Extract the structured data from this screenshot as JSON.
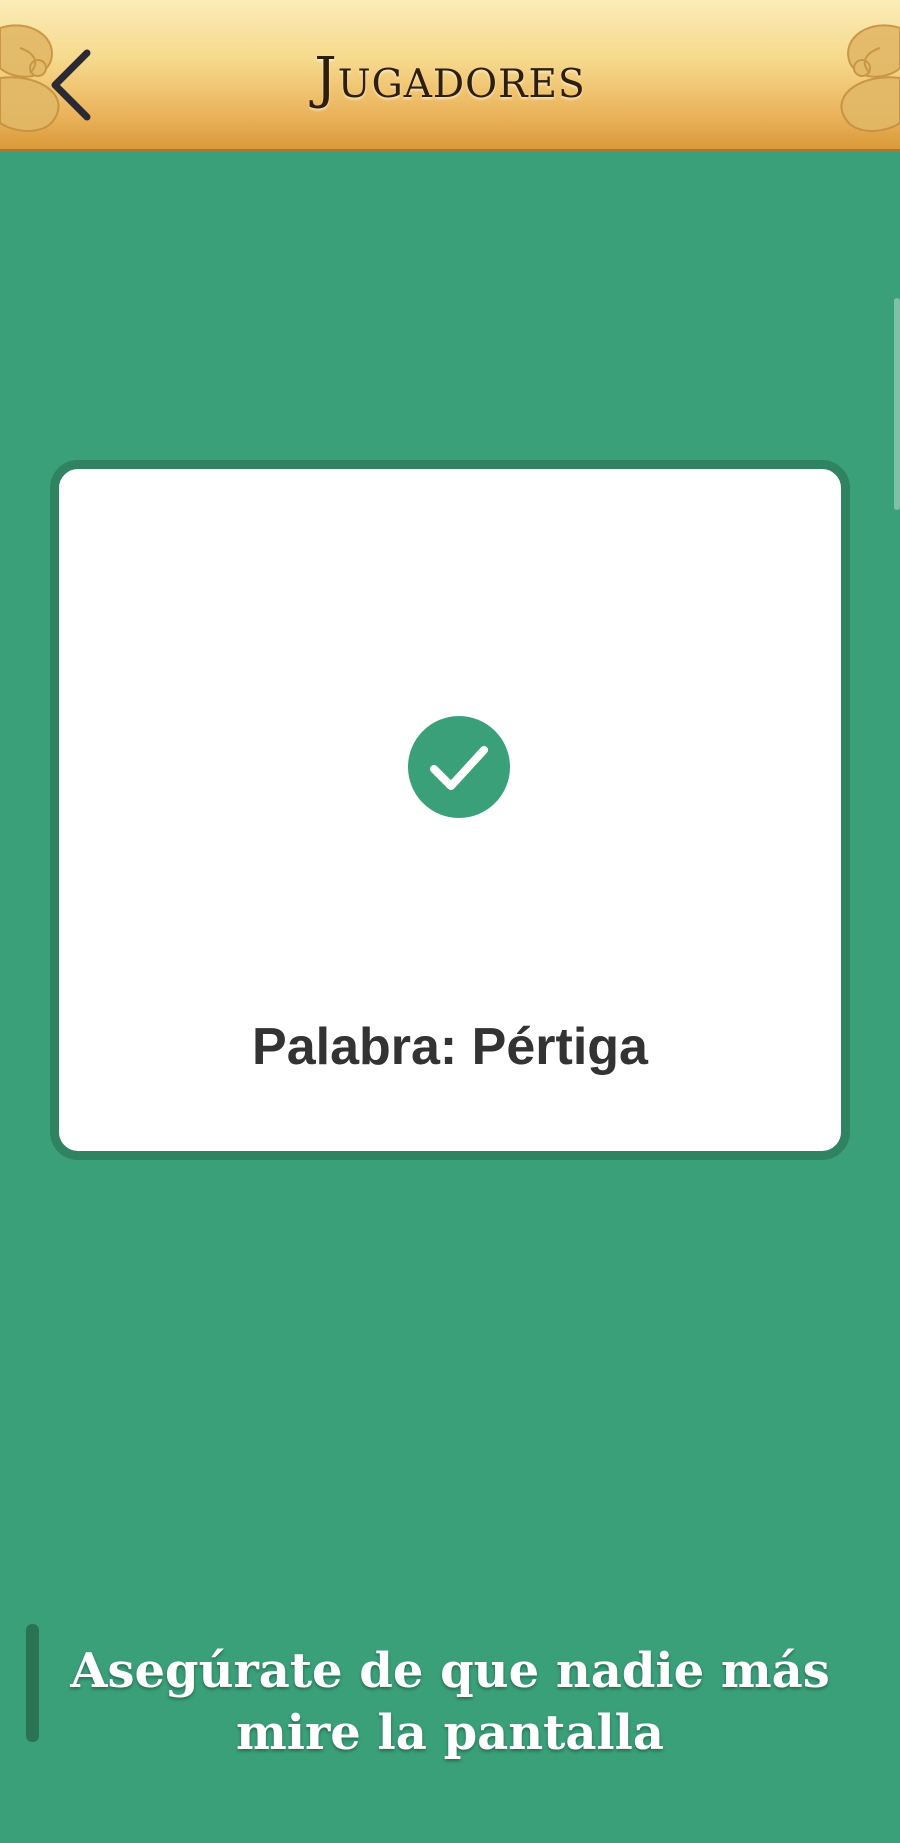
{
  "header": {
    "title": "Jugadores",
    "back_icon": "chevron-left-icon"
  },
  "card": {
    "status_icon": "check-circle-icon",
    "word_text": "Palabra: Pértiga"
  },
  "footer": {
    "warning_text": "Asegúrate de que nadie más mire la pantalla"
  },
  "colors": {
    "background": "#3aa07a",
    "card_border": "#2f8360",
    "accent": "#3aa07a",
    "header_gold": "#eab25a"
  }
}
